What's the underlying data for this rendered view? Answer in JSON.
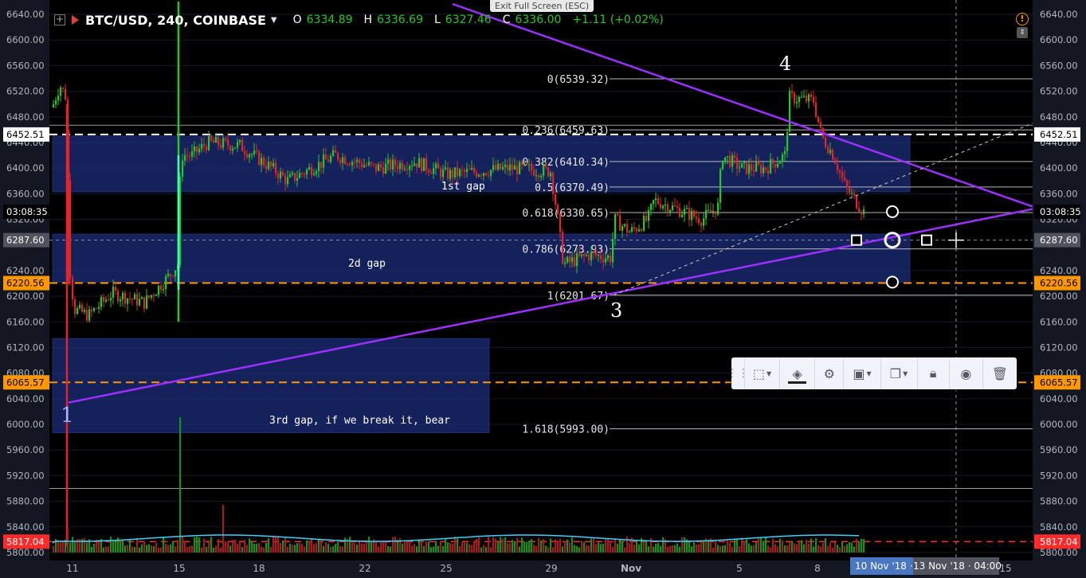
{
  "window": {
    "exit_fullscreen": "Exit Full Screen (ESC)"
  },
  "legend": {
    "symbol": "BTC/USD, 240, COINBASE",
    "open_label": "O",
    "open": "6334.89",
    "high_label": "H",
    "high": "6336.69",
    "low_label": "L",
    "low": "6327.46",
    "close_label": "C",
    "close": "6336.00",
    "change": "+1.11 (+0.02%)"
  },
  "price_axis": {
    "ticks": [
      "6640.00",
      "6600.00",
      "6560.00",
      "6520.00",
      "6480.00",
      "6440.00",
      "6400.00",
      "6360.00",
      "6320.00",
      "6240.00",
      "6200.00",
      "6160.00",
      "6120.00",
      "6080.00",
      "6040.00",
      "6000.00",
      "5960.00",
      "5920.00",
      "5880.00",
      "5840.00",
      "5800.00"
    ],
    "tick_values": [
      6640,
      6600,
      6560,
      6520,
      6480,
      6440,
      6400,
      6360,
      6320,
      6240,
      6200,
      6160,
      6120,
      6080,
      6040,
      6000,
      5960,
      5920,
      5880,
      5840,
      5800
    ],
    "markers": [
      {
        "name": "level-6452",
        "label": "6452.51",
        "value": 6452.51,
        "bg": "#ffffff",
        "fg": "#000000"
      },
      {
        "name": "countdown",
        "label": "03:08:35",
        "value": 6332,
        "bg": "#000000",
        "fg": "#ffffff"
      },
      {
        "name": "crosshair-price",
        "label": "6287.60",
        "value": 6287.6,
        "bg": "#50535e",
        "fg": "#ffffff"
      },
      {
        "name": "level-6220",
        "label": "6220.56",
        "value": 6220.56,
        "bg": "#ff9800",
        "fg": "#000000"
      },
      {
        "name": "level-6065",
        "label": "6065.57",
        "value": 6065.57,
        "bg": "#ff9800",
        "fg": "#000000"
      },
      {
        "name": "level-5817",
        "label": "5817.04",
        "value": 5817.04,
        "bg": "#ff2a2a",
        "fg": "#ffffff"
      }
    ]
  },
  "time_axis": {
    "labels": [
      "11",
      "15",
      "18",
      "22",
      "25",
      "29",
      "Nov",
      "5",
      "8",
      "15"
    ],
    "bold": [
      "Nov"
    ]
  },
  "time_tags": {
    "a": "10 Nov '18 · 20:00",
    "b": "13 Nov '18 · 04:00"
  },
  "annotations": {
    "wave_1": "1",
    "wave_3": "3",
    "wave_4": "4",
    "gap_1": "1st gap",
    "gap_2": "2d gap",
    "gap_3": "3rd gap, if we break it, bear"
  },
  "fib": [
    {
      "label": "0(6539.32)",
      "value": 6539.32
    },
    {
      "label": "0.236(6459.63)",
      "value": 6459.63
    },
    {
      "label": "0.382(6410.34)",
      "value": 6410.34
    },
    {
      "label": "0.5(6370.49)",
      "value": 6370.49
    },
    {
      "label": "0.618(6330.65)",
      "value": 6330.65
    },
    {
      "label": "0.786(6273.93)",
      "value": 6273.93
    },
    {
      "label": "1(6201.67)",
      "value": 6201.67
    },
    {
      "label": "1.618(5993.00)",
      "value": 5993.0
    }
  ],
  "colors": {
    "up": "#26c826",
    "down": "#e0262a",
    "trend": "#9b30ff",
    "gap_box": "#1c2d78",
    "orange": "#ff9800",
    "volume_ma": "#40d0ff"
  },
  "toolbar_icons": [
    "grip-icon",
    "rectangle-select-icon",
    "fill-bucket-icon",
    "gear-icon",
    "layers-icon",
    "clone-icon",
    "lock-icon",
    "eye-icon",
    "trash-icon"
  ]
}
